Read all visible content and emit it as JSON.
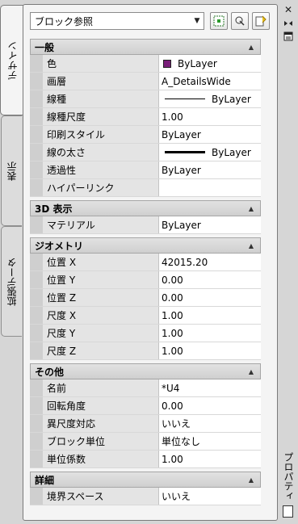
{
  "tabs": [
    {
      "label": "デザイン"
    },
    {
      "label": "表示"
    },
    {
      "label": "拡張データ"
    }
  ],
  "selector": {
    "value": "ブロック参照"
  },
  "palette_title": "プロパティ",
  "sections": {
    "general": {
      "title": "一般",
      "rows": [
        {
          "name": "色",
          "value": "ByLayer"
        },
        {
          "name": "画層",
          "value": "A_DetailsWide"
        },
        {
          "name": "線種",
          "value": "ByLayer"
        },
        {
          "name": "線種尺度",
          "value": "1.00"
        },
        {
          "name": "印刷スタイル",
          "value": "ByLayer"
        },
        {
          "name": "線の太さ",
          "value": "ByLayer"
        },
        {
          "name": "透過性",
          "value": "ByLayer"
        },
        {
          "name": "ハイパーリンク",
          "value": ""
        }
      ]
    },
    "view3d": {
      "title": "3D 表示",
      "rows": [
        {
          "name": "マテリアル",
          "value": "ByLayer"
        }
      ]
    },
    "geometry": {
      "title": "ジオメトリ",
      "rows": [
        {
          "name": "位置 X",
          "value": "42015.20"
        },
        {
          "name": "位置 Y",
          "value": "0.00"
        },
        {
          "name": "位置 Z",
          "value": "0.00"
        },
        {
          "name": "尺度 X",
          "value": "1.00"
        },
        {
          "name": "尺度 Y",
          "value": "1.00"
        },
        {
          "name": "尺度 Z",
          "value": "1.00"
        }
      ]
    },
    "other": {
      "title": "その他",
      "rows": [
        {
          "name": "名前",
          "value": "*U4"
        },
        {
          "name": "回転角度",
          "value": "0.00"
        },
        {
          "name": "異尺度対応",
          "value": "いいえ"
        },
        {
          "name": "ブロック単位",
          "value": "単位なし"
        },
        {
          "name": "単位係数",
          "value": "1.00"
        }
      ]
    },
    "details": {
      "title": "詳細",
      "rows": [
        {
          "name": "境界スペース",
          "value": "いいえ"
        }
      ]
    }
  },
  "colors": {
    "color_swatch": "#7a1f7a"
  }
}
